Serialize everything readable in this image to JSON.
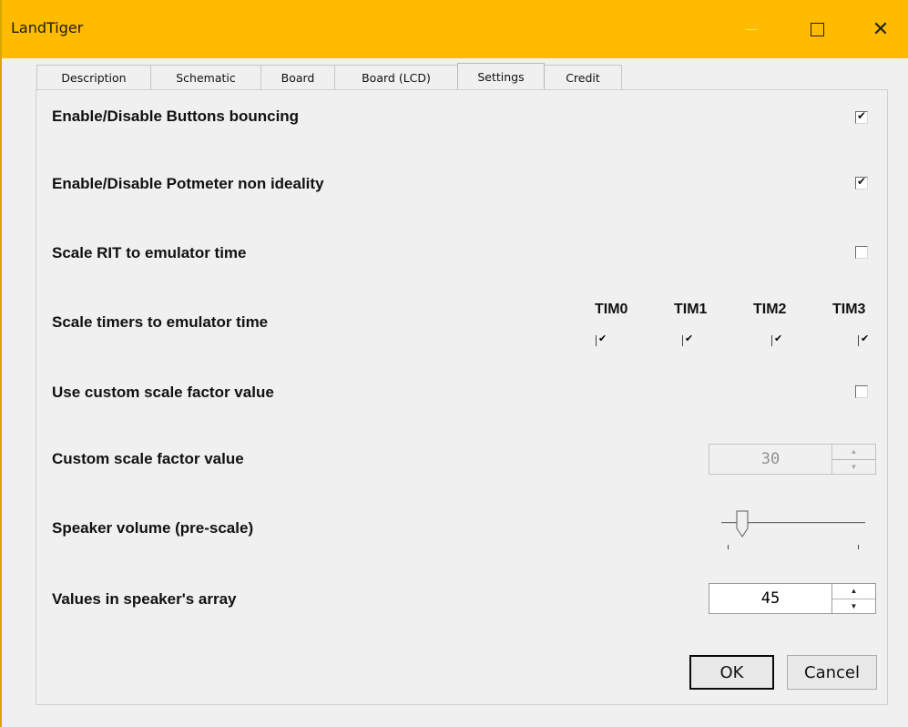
{
  "window": {
    "title": "LandTiger",
    "minimize": "—",
    "maximize": "□",
    "close": "✕"
  },
  "tabs": [
    {
      "label": "Description",
      "active": false
    },
    {
      "label": "Schematic",
      "active": false
    },
    {
      "label": "Board",
      "active": false
    },
    {
      "label": "Board (LCD)",
      "active": false
    },
    {
      "label": "Settings",
      "active": true
    },
    {
      "label": "Credit",
      "active": false
    }
  ],
  "settings": {
    "buttons_bouncing": {
      "label": "Enable/Disable Buttons bouncing",
      "checked": true
    },
    "potmeter": {
      "label": "Enable/Disable Potmeter non ideality",
      "checked": true
    },
    "scale_rit": {
      "label": "Scale RIT to emulator time",
      "checked": false
    },
    "scale_timers": {
      "label": "Scale timers to emulator time",
      "timers": [
        {
          "name": "TIM0",
          "checked": true
        },
        {
          "name": "TIM1",
          "checked": true
        },
        {
          "name": "TIM2",
          "checked": true
        },
        {
          "name": "TIM3",
          "checked": true
        }
      ]
    },
    "use_custom_scale": {
      "label": "Use custom scale factor value",
      "checked": false
    },
    "custom_scale": {
      "label": "Custom scale factor value",
      "value": "30",
      "enabled": false
    },
    "speaker_volume": {
      "label": "Speaker volume (pre-scale)",
      "level": 0.1
    },
    "speaker_values": {
      "label": "Values in speaker's array",
      "value": "45"
    }
  },
  "buttons": {
    "ok": "OK",
    "cancel": "Cancel"
  },
  "colors": {
    "titlebar": "#ffbb00",
    "panel": "#f0f0f0"
  }
}
